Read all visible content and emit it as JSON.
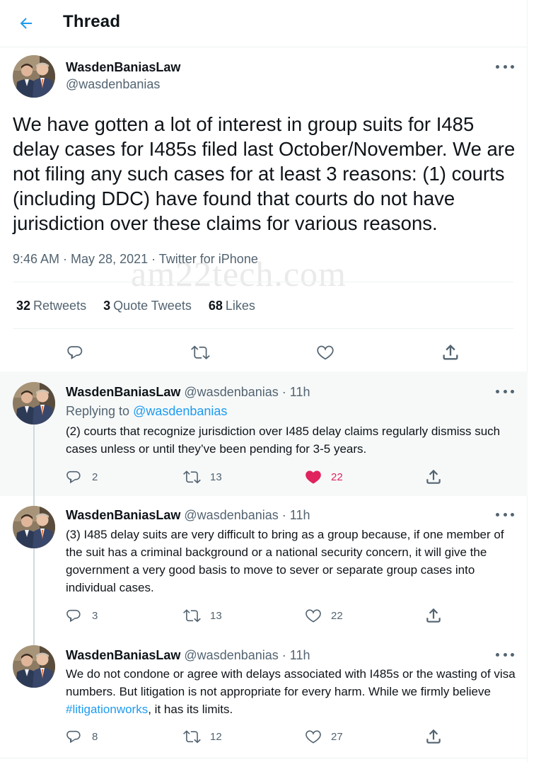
{
  "header": {
    "title": "Thread",
    "back_icon": "arrow-left-icon"
  },
  "main_tweet": {
    "display_name": "WasdenBaniasLaw",
    "handle": "@wasdenbanias",
    "text": "We have gotten a lot of interest in group suits for I485 delay cases for I485s filed last October/November. We are not filing any such cases for at least 3 reasons: (1) courts (including DDC) have found that courts do not have jurisdiction over these claims for various reasons.",
    "meta": "9:46 AM · May 28, 2021 · Twitter for iPhone",
    "watermark": "am22tech.com",
    "stats": {
      "retweets_count": "32",
      "retweets_label": "Retweets",
      "quotes_count": "3",
      "quotes_label": "Quote Tweets",
      "likes_count": "68",
      "likes_label": "Likes"
    }
  },
  "replies": [
    {
      "display_name": "WasdenBaniasLaw",
      "handle": "@wasdenbanias",
      "dot": "·",
      "time": "11h",
      "replying_prefix": "Replying to",
      "replying_to": "@wasdenbanias",
      "text": "(2) courts that recognize jurisdiction over I485 delay claims regularly dismiss such cases unless or until they’ve been pending for 3-5 years.",
      "reply_count": "2",
      "retweet_count": "13",
      "like_count": "22",
      "liked": true
    },
    {
      "display_name": "WasdenBaniasLaw",
      "handle": "@wasdenbanias",
      "dot": "·",
      "time": "11h",
      "text": "(3) I485 delay suits are very difficult to bring as a group because, if one member of the suit has a criminal background or a national security concern, it will give the government a very good basis to move to sever or separate group cases into individual cases.",
      "reply_count": "3",
      "retweet_count": "13",
      "like_count": "22",
      "liked": false
    },
    {
      "display_name": "WasdenBaniasLaw",
      "handle": "@wasdenbanias",
      "dot": "·",
      "time": "11h",
      "text_before": "We do not condone or agree with delays associated with I485s or the wasting of visa numbers. But litigation is not appropriate for every harm. While we firmly believe ",
      "hashtag": "#litigationworks",
      "text_after": ", it has its limits.",
      "reply_count": "8",
      "retweet_count": "12",
      "like_count": "27",
      "liked": false
    }
  ],
  "colors": {
    "accent": "#1d9bf0",
    "like": "#f91880",
    "muted": "#536471",
    "text": "#0f1419",
    "highlight_bg": "#f7f9f9"
  }
}
